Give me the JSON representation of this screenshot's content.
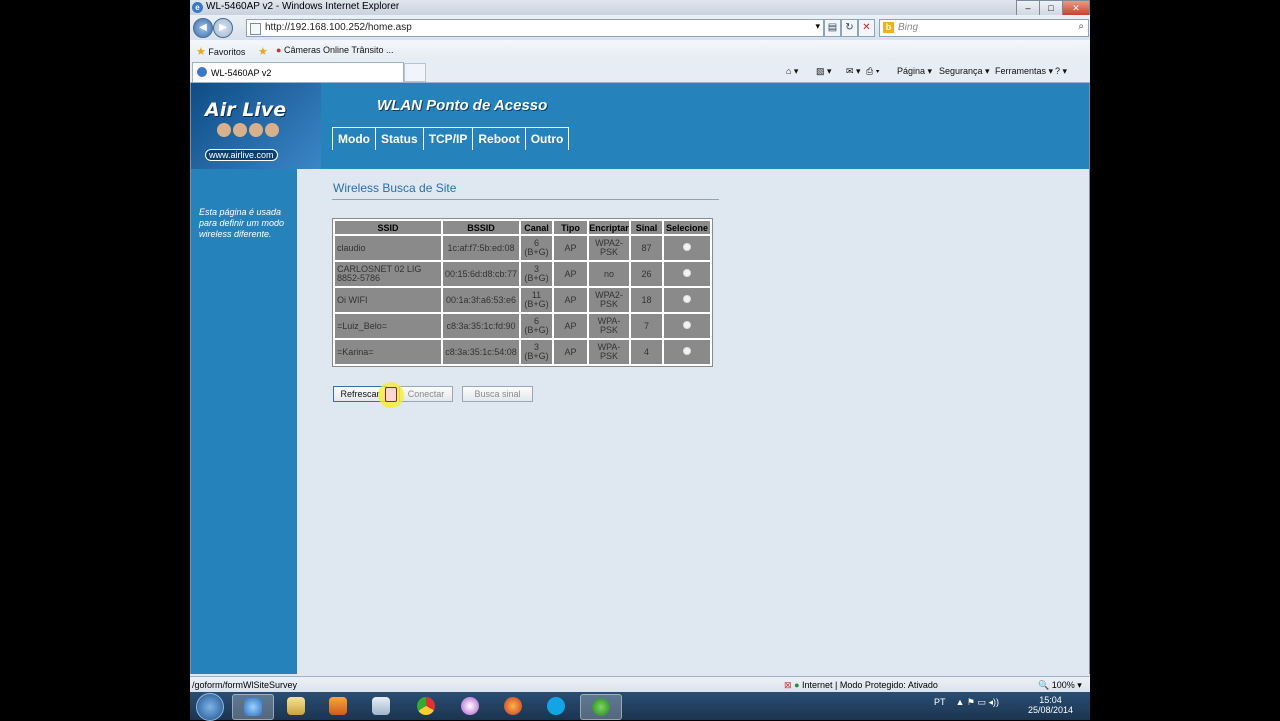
{
  "window": {
    "title": "WL-5460AP v2 - Windows Internet Explorer"
  },
  "browser": {
    "url": "http://192.168.100.252/home.asp",
    "search_placeholder": "Bing",
    "favorites_label": "Favoritos",
    "fav_item": "Câmeras Online  Trânsito ...",
    "tab_label": "WL-5460AP v2",
    "cmd": {
      "page": "Página",
      "security": "Segurança",
      "tools": "Ferramentas"
    }
  },
  "router": {
    "brand": "Air Live",
    "brand_url": "www.airlive.com",
    "page_title": "WLAN Ponto de Acesso",
    "menu": [
      "Modo",
      "Status",
      "TCP/IP",
      "Reboot",
      "Outro"
    ],
    "sidebar_text": "Esta página é usada para definir um modo wireless diferente.",
    "section_title": "Wireless Busca de Site",
    "table_headers": [
      "SSID",
      "BSSID",
      "Canal",
      "Tipo",
      "Encriptar",
      "Sinal",
      "Selecione"
    ],
    "rows": [
      {
        "ssid": "claudio",
        "bssid": "1c:af:f7:5b:ed:08",
        "channel": "6 (B+G)",
        "type": "AP",
        "encrypt": "WPA2-PSK",
        "signal": "87"
      },
      {
        "ssid": "CARLOSNET 02 LIG 8852-5786",
        "bssid": "00:15:6d:d8:cb:77",
        "channel": "3 (B+G)",
        "type": "AP",
        "encrypt": "no",
        "signal": "26"
      },
      {
        "ssid": "Oi WIFI",
        "bssid": "00:1a:3f:a6:53:e6",
        "channel": "11 (B+G)",
        "type": "AP",
        "encrypt": "WPA2-PSK",
        "signal": "18"
      },
      {
        "ssid": "=Luiz_Belo=",
        "bssid": "c8:3a:35:1c:fd:90",
        "channel": "6 (B+G)",
        "type": "AP",
        "encrypt": "WPA-PSK",
        "signal": "7"
      },
      {
        "ssid": "=Karina=",
        "bssid": "c8:3a:35:1c:54:08",
        "channel": "3 (B+G)",
        "type": "AP",
        "encrypt": "WPA-PSK",
        "signal": "4"
      }
    ],
    "buttons": {
      "refresh": "Refrescar",
      "connect": "Conectar",
      "scan": "Busca sinal"
    }
  },
  "status": {
    "link": "/goform/formWlSiteSurvey",
    "zone": "Internet | Modo Protegido: Ativado",
    "zoom": "100%"
  },
  "taskbar": {
    "lang": "PT",
    "time": "15:04",
    "date": "25/08/2014"
  }
}
